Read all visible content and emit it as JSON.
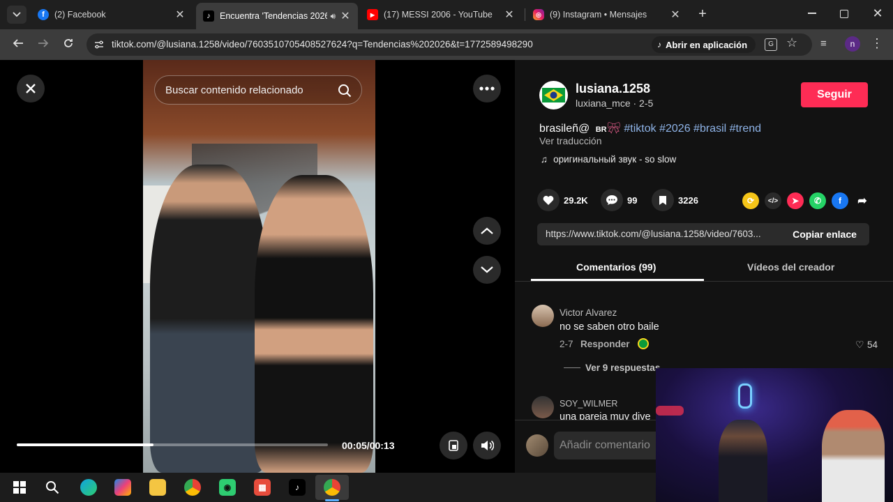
{
  "tabs": [
    {
      "title": "(2) Facebook",
      "icon": "facebook-icon"
    },
    {
      "title": "Encuentra 'Tendencias 2026",
      "icon": "tiktok-icon"
    },
    {
      "title": "(17) MESSI 2006 - YouTube",
      "icon": "youtube-icon"
    },
    {
      "title": "(9) Instagram • Mensajes",
      "icon": "instagram-icon"
    }
  ],
  "address": {
    "url": "tiktok.com/@lusiana.1258/video/7603510705408527624?q=Tendencias%202026&t=1772589498290",
    "open_app": "Abrir en aplicación",
    "profile_initial": "n"
  },
  "video": {
    "search_placeholder": "Buscar contenido relacionado",
    "time": "00:05/00:13",
    "progress": 0.44
  },
  "author": {
    "name": "lusiana.1258",
    "handle": "luxiana_mce · 2-5",
    "follow_label": "Seguir"
  },
  "description": {
    "text": "brasileñ@",
    "badge": "BR",
    "tags": [
      "#tiktok",
      "#2026",
      "#brasil",
      "#trend"
    ],
    "translate": "Ver traducción",
    "music": "оригинальный звук - so slow"
  },
  "stats": {
    "likes": "29.2K",
    "comments": "99",
    "saves": "3226"
  },
  "share": {
    "link": "https://www.tiktok.com/@lusiana.1258/video/7603...",
    "copy_label": "Copiar enlace"
  },
  "panel_tabs": {
    "comments": "Comentarios (99)",
    "creator_videos": "Vídeos del creador"
  },
  "comments": [
    {
      "name": "Victor Alvarez",
      "text": "no se saben otro baile",
      "date": "2-7",
      "reply": "Responder",
      "likes": "54",
      "replies": "Ver 9 respuestas"
    },
    {
      "name": "SOY_WILMER",
      "text": "una pareja muy dive"
    }
  ],
  "comment_input": {
    "placeholder": "Añadir comentario"
  },
  "colors": {
    "follow": "#fe2c55",
    "tag": "#8fb4e8",
    "panel_bg": "#121212"
  }
}
